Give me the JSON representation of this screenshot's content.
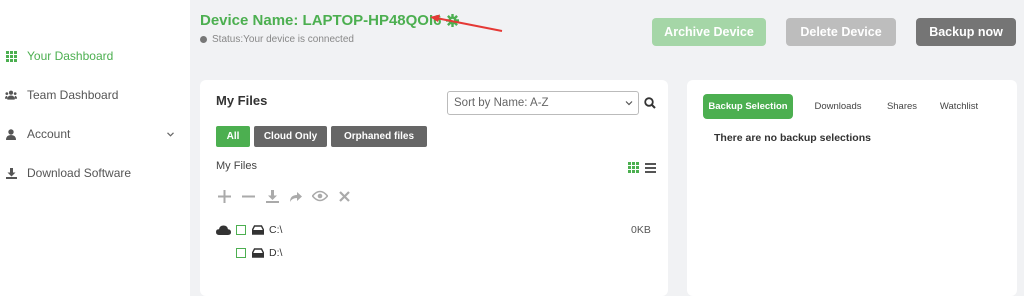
{
  "sidebar": {
    "items": [
      {
        "label": "Your Dashboard",
        "icon": "grid-icon",
        "active": true
      },
      {
        "label": "Team Dashboard",
        "icon": "team-icon"
      },
      {
        "label": "Account",
        "icon": "user-icon",
        "has_submenu": true
      },
      {
        "label": "Download Software",
        "icon": "download-icon"
      }
    ]
  },
  "device": {
    "name": "Device Name: LAPTOP-HP48QOI6",
    "status": "Status:Your device is connected"
  },
  "actions": {
    "archive": "Archive Device",
    "delete": "Delete Device",
    "backup": "Backup now"
  },
  "files": {
    "title": "My Files",
    "sort_value": "Sort by Name: A-Z",
    "filters": [
      "All",
      "Cloud Only",
      "Orphaned files"
    ],
    "path_label": "My Files",
    "drives": [
      {
        "label": "C:\\",
        "size": "0KB"
      },
      {
        "label": "D:\\"
      }
    ]
  },
  "backup_panel": {
    "tabs": [
      "Backup Selection",
      "Downloads",
      "Shares",
      "Watchlist"
    ],
    "empty_message": "There are no backup selections"
  },
  "colors": {
    "accent": "#4caf50",
    "archive_btn": "#a5d6a7",
    "delete_btn": "#bdbdbd",
    "backup_btn": "#757575",
    "annotation_arrow": "#e53935"
  }
}
